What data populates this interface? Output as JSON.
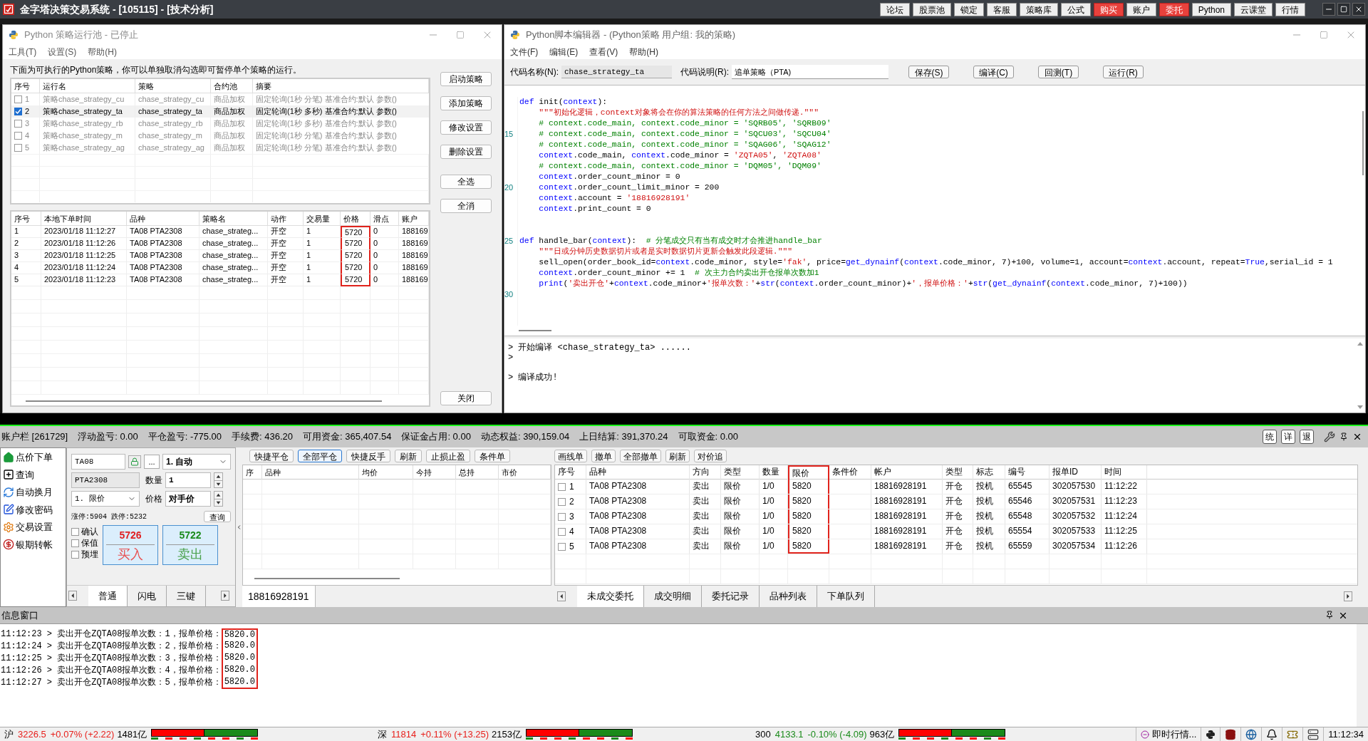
{
  "app": {
    "title": "金字塔决策交易系统 - [105115] - [技术分析]",
    "toolbar": [
      {
        "label": "论坛",
        "alert": false
      },
      {
        "label": "股票池",
        "alert": false
      },
      {
        "label": "锁定",
        "alert": false
      },
      {
        "label": "客服",
        "alert": false
      },
      {
        "label": "策略库",
        "alert": false
      },
      {
        "label": "公式",
        "alert": false
      },
      {
        "label": "购买",
        "alert": true
      },
      {
        "label": "账户",
        "alert": false
      },
      {
        "label": "委托",
        "alert": true
      },
      {
        "label": "Python",
        "alert": false
      },
      {
        "label": "云课堂",
        "alert": false
      },
      {
        "label": "行情",
        "alert": false
      }
    ]
  },
  "strategy_pool": {
    "title": "Python 策略运行池 - 已停止",
    "menu": [
      "工具(T)",
      "设置(S)",
      "帮助(H)"
    ],
    "description": "下面为可执行的Python策略，你可以单独取消勾选即可暂停单个策略的运行。",
    "columns": [
      "序号",
      "运行名",
      "策略",
      "合约池",
      "摘要"
    ],
    "strategies": [
      {
        "index": "1",
        "run_name": "策略chase_strategy_cu",
        "strategy": "chase_strategy_cu",
        "pool": "商品加权",
        "summary": "固定轮询(1秒 分笔) 基准合约:默认 参数()",
        "checked": false
      },
      {
        "index": "2",
        "run_name": "策略chase_strategy_ta",
        "strategy": "chase_strategy_ta",
        "pool": "商品加权",
        "summary": "固定轮询(1秒 多秒) 基准合约:默认 参数()",
        "checked": true
      },
      {
        "index": "3",
        "run_name": "策略chase_strategy_rb",
        "strategy": "chase_strategy_rb",
        "pool": "商品加权",
        "summary": "固定轮询(1秒 多秒) 基准合约:默认 参数()",
        "checked": false
      },
      {
        "index": "4",
        "run_name": "策略chase_strategy_m",
        "strategy": "chase_strategy_m",
        "pool": "商品加权",
        "summary": "固定轮询(1秒 分笔) 基准合约:默认 参数()",
        "checked": false
      },
      {
        "index": "5",
        "run_name": "策略chase_strategy_ag",
        "strategy": "chase_strategy_ag",
        "pool": "商品加权",
        "summary": "固定轮询(1秒 分笔) 基准合约:默认 参数()",
        "checked": false
      }
    ],
    "log_columns": [
      {
        "label": "序号",
        "highlighted": false
      },
      {
        "label": "本地下单时间",
        "highlighted": false
      },
      {
        "label": "品种",
        "highlighted": false
      },
      {
        "label": "策略名",
        "highlighted": false
      },
      {
        "label": "动作",
        "highlighted": false
      },
      {
        "label": "交易量",
        "highlighted": false
      },
      {
        "label": "价格",
        "highlighted": true
      },
      {
        "label": "滑点",
        "highlighted": false
      },
      {
        "label": "账户",
        "highlighted": false
      }
    ],
    "log_rows": [
      [
        "1",
        "2023/01/18 11:12:27",
        "TA08 PTA2308",
        "chase_strateg...",
        "开空",
        "1",
        "5720",
        "0",
        "188169"
      ],
      [
        "2",
        "2023/01/18 11:12:26",
        "TA08 PTA2308",
        "chase_strateg...",
        "开空",
        "1",
        "5720",
        "0",
        "188169"
      ],
      [
        "3",
        "2023/01/18 11:12:25",
        "TA08 PTA2308",
        "chase_strateg...",
        "开空",
        "1",
        "5720",
        "0",
        "188169"
      ],
      [
        "4",
        "2023/01/18 11:12:24",
        "TA08 PTA2308",
        "chase_strateg...",
        "开空",
        "1",
        "5720",
        "0",
        "188169"
      ],
      [
        "5",
        "2023/01/18 11:12:23",
        "TA08 PTA2308",
        "chase_strateg...",
        "开空",
        "1",
        "5720",
        "0",
        "188169"
      ]
    ],
    "side_buttons": [
      "启动策略",
      "添加策略",
      "修改设置",
      "删除设置",
      "全选",
      "全消"
    ],
    "close_button": "关闭"
  },
  "editor": {
    "title": "Python脚本编辑器 - (Python策略 用户组: 我的策略)",
    "menu": [
      "文件(F)",
      "编辑(E)",
      "查看(V)",
      "帮助(H)"
    ],
    "code_name_label": "代码名称(N):",
    "code_name": "chase_strategy_ta",
    "code_desc_label": "代码说明(R):",
    "code_desc": "追单策略（PTA)",
    "buttons": [
      "保存(S)",
      "编译(C)",
      "回测(T)",
      "运行(R)"
    ],
    "lines": [
      {
        "kind": "code",
        "tokens": [
          {
            "kind": "kw",
            "text": "def"
          },
          {
            "kind": "txt",
            "text": " init("
          },
          {
            "kind": "kw",
            "text": "context"
          },
          {
            "kind": "txt",
            "text": "):"
          }
        ]
      },
      {
        "kind": "code",
        "tokens": [
          {
            "kind": "str",
            "text": "    \"\"\"初始化逻辑，context对象将会在你的算法策略的任何方法之间做传递.\"\"\""
          }
        ]
      },
      {
        "kind": "code",
        "tokens": [
          {
            "kind": "cmt",
            "text": "    # context.code_main, context.code_minor = 'SQRB05', 'SQRB09'"
          }
        ]
      },
      {
        "kind": "code",
        "number": "15",
        "tokens": [
          {
            "kind": "cmt",
            "text": "    # context.code_main, context.code_minor = 'SQCU03', 'SQCU04'"
          }
        ]
      },
      {
        "kind": "code",
        "tokens": [
          {
            "kind": "cmt",
            "text": "    # context.code_main, context.code_minor = 'SQAG06', 'SQAG12'"
          }
        ]
      },
      {
        "kind": "code",
        "tokens": [
          {
            "kind": "kw",
            "text": "    context"
          },
          {
            "kind": "txt",
            "text": ".code_main, "
          },
          {
            "kind": "kw",
            "text": "context"
          },
          {
            "kind": "txt",
            "text": ".code_minor = "
          },
          {
            "kind": "str",
            "text": "'ZQTA05'"
          },
          {
            "kind": "txt",
            "text": ", "
          },
          {
            "kind": "str",
            "text": "'ZQTA08'"
          }
        ]
      },
      {
        "kind": "code",
        "tokens": [
          {
            "kind": "cmt",
            "text": "    # context.code_main, context.code_minor = 'DQM05', 'DQM09'"
          }
        ]
      },
      {
        "kind": "code",
        "tokens": [
          {
            "kind": "kw",
            "text": "    context"
          },
          {
            "kind": "txt",
            "text": ".order_count_minor = 0"
          }
        ]
      },
      {
        "kind": "code",
        "number": "20",
        "tokens": [
          {
            "kind": "kw",
            "text": "    context"
          },
          {
            "kind": "txt",
            "text": ".order_count_limit_minor = 200"
          }
        ]
      },
      {
        "kind": "code",
        "tokens": [
          {
            "kind": "kw",
            "text": "    context"
          },
          {
            "kind": "txt",
            "text": ".account = "
          },
          {
            "kind": "str",
            "text": "'18816928191'"
          }
        ]
      },
      {
        "kind": "code",
        "tokens": [
          {
            "kind": "kw",
            "text": "    context"
          },
          {
            "kind": "txt",
            "text": ".print_count = 0"
          }
        ]
      },
      {
        "kind": "blank"
      },
      {
        "kind": "blank"
      },
      {
        "kind": "code",
        "number": "25",
        "tokens": [
          {
            "kind": "kw",
            "text": "def"
          },
          {
            "kind": "txt",
            "text": " handle_bar("
          },
          {
            "kind": "kw",
            "text": "context"
          },
          {
            "kind": "txt",
            "text": "):  "
          },
          {
            "kind": "cmt",
            "text": "# 分笔成交只有当有成交时才会推进handle_bar"
          }
        ]
      },
      {
        "kind": "code",
        "tokens": [
          {
            "kind": "str",
            "text": "    \"\"\"日或分钟历史数据切片或者是实时数据切片更新会触发此段逻辑.\"\"\""
          }
        ]
      },
      {
        "kind": "code",
        "tokens": [
          {
            "kind": "txt",
            "text": "    sell_open(order_book_id="
          },
          {
            "kind": "kw",
            "text": "context"
          },
          {
            "kind": "txt",
            "text": ".code_minor, style="
          },
          {
            "kind": "str",
            "text": "'fak'"
          },
          {
            "kind": "txt",
            "text": ", price="
          },
          {
            "kind": "kw",
            "text": "get_dynainf"
          },
          {
            "kind": "txt",
            "text": "("
          },
          {
            "kind": "kw",
            "text": "context"
          },
          {
            "kind": "txt",
            "text": ".code_minor, 7)+100, volume=1, account="
          },
          {
            "kind": "kw",
            "text": "context"
          },
          {
            "kind": "txt",
            "text": ".account, repeat="
          },
          {
            "kind": "kw",
            "text": "True"
          },
          {
            "kind": "txt",
            "text": ",serial_id = 1"
          }
        ]
      },
      {
        "kind": "code",
        "tokens": [
          {
            "kind": "kw",
            "text": "    context"
          },
          {
            "kind": "txt",
            "text": ".order_count_minor += 1  "
          },
          {
            "kind": "cmt",
            "text": "# 次主力合约卖出开仓报单次数加1"
          }
        ]
      },
      {
        "kind": "code",
        "tokens": [
          {
            "kind": "kw",
            "text": "    print"
          },
          {
            "kind": "txt",
            "text": "("
          },
          {
            "kind": "str",
            "text": "'卖出开仓'"
          },
          {
            "kind": "txt",
            "text": "+"
          },
          {
            "kind": "kw",
            "text": "context"
          },
          {
            "kind": "txt",
            "text": ".code_minor+"
          },
          {
            "kind": "str",
            "text": "'报单次数：'"
          },
          {
            "kind": "txt",
            "text": "+"
          },
          {
            "kind": "kw",
            "text": "str"
          },
          {
            "kind": "txt",
            "text": "("
          },
          {
            "kind": "kw",
            "text": "context"
          },
          {
            "kind": "txt",
            "text": ".order_count_minor)+"
          },
          {
            "kind": "str",
            "text": "'，报单价格：'"
          },
          {
            "kind": "txt",
            "text": "+"
          },
          {
            "kind": "kw",
            "text": "str"
          },
          {
            "kind": "txt",
            "text": "("
          },
          {
            "kind": "kw",
            "text": "get_dynainf"
          },
          {
            "kind": "txt",
            "text": "("
          },
          {
            "kind": "kw",
            "text": "context"
          },
          {
            "kind": "txt",
            "text": ".code_minor, 7)+100))"
          }
        ]
      },
      {
        "kind": "blank",
        "number": "30"
      }
    ],
    "output": [
      "> 开始编译 <chase_strategy_ta> ......",
      ">",
      "> 编译成功!"
    ]
  },
  "account_bar": {
    "items": [
      "账户栏 [261729]",
      "浮动盈亏: 0.00",
      "平仓盈亏: -775.00",
      "手续费: 436.20",
      "可用资金: 365,407.54",
      "保证金占用: 0.00",
      "动态权益: 390,159.04",
      "上日结算: 391,370.24",
      "可取资金: 0.00"
    ],
    "buttons": [
      "统",
      "详",
      "退"
    ]
  },
  "nav": [
    "点价下单",
    "查询",
    "自动换月",
    "修改密码",
    "交易设置",
    "银期转帐"
  ],
  "order_form": {
    "contract": "TA08",
    "more_button": "...",
    "mode": "1. 自动",
    "product": "PTA2308",
    "qty_label": "数量",
    "qty": "1",
    "order_type": "1. 限价",
    "price_label": "价格",
    "price": "对手价",
    "limits": "涨停:5904 跌停:5232",
    "query_button": "查询",
    "options": [
      {
        "label": "确认",
        "checked": false
      },
      {
        "label": "保值",
        "checked": false
      },
      {
        "label": "预埋",
        "checked": false
      }
    ],
    "buy": {
      "price": "5726",
      "label": "买入"
    },
    "sell": {
      "price": "5722",
      "label": "卖出"
    },
    "tabs": [
      {
        "label": "普通",
        "selected": true
      },
      {
        "label": "闪电",
        "selected": false
      },
      {
        "label": "三键",
        "selected": false
      }
    ]
  },
  "positions": {
    "toolbar": [
      {
        "label": "快捷平仓",
        "selected": false
      },
      {
        "label": "全部平仓",
        "selected": true
      },
      {
        "label": "快捷反手",
        "selected": false
      },
      {
        "label": "刷新",
        "selected": false
      },
      {
        "label": "止损止盈",
        "selected": false
      },
      {
        "label": "条件单",
        "selected": false
      }
    ],
    "columns": [
      "序",
      "品种",
      "均价",
      "今持",
      "总持",
      "市价"
    ],
    "account_tab": "18816928191"
  },
  "orders": {
    "toolbar": [
      "画线单",
      "撤单",
      "全部撤单",
      "刷新",
      "对价追"
    ],
    "columns": [
      {
        "label": "序号",
        "highlighted": false
      },
      {
        "label": "品种",
        "highlighted": false
      },
      {
        "label": "方向",
        "highlighted": false
      },
      {
        "label": "类型",
        "highlighted": false
      },
      {
        "label": "数量",
        "highlighted": false
      },
      {
        "label": "限价",
        "highlighted": true
      },
      {
        "label": "条件价",
        "highlighted": false
      },
      {
        "label": "帐户",
        "highlighted": false
      },
      {
        "label": "类型",
        "highlighted": false
      },
      {
        "label": "标志",
        "highlighted": false
      },
      {
        "label": "编号",
        "highlighted": false
      },
      {
        "label": "报单ID",
        "highlighted": false
      },
      {
        "label": "时间",
        "highlighted": false
      }
    ],
    "rows": [
      {
        "index": "1",
        "contract": "TA08 PTA2308",
        "direction": "卖出",
        "type": "限价",
        "qty": "1/0",
        "limit_price": "5820",
        "account": "18816928191",
        "open_close": "开仓",
        "flag": "投机",
        "order_no": "65545",
        "order_id": "302057530",
        "time": "11:12:22",
        "checked": false
      },
      {
        "index": "2",
        "contract": "TA08 PTA2308",
        "direction": "卖出",
        "type": "限价",
        "qty": "1/0",
        "limit_price": "5820",
        "account": "18816928191",
        "open_close": "开仓",
        "flag": "投机",
        "order_no": "65546",
        "order_id": "302057531",
        "time": "11:12:23",
        "checked": false
      },
      {
        "index": "3",
        "contract": "TA08 PTA2308",
        "direction": "卖出",
        "type": "限价",
        "qty": "1/0",
        "limit_price": "5820",
        "account": "18816928191",
        "open_close": "开仓",
        "flag": "投机",
        "order_no": "65548",
        "order_id": "302057532",
        "time": "11:12:24",
        "checked": false
      },
      {
        "index": "4",
        "contract": "TA08 PTA2308",
        "direction": "卖出",
        "type": "限价",
        "qty": "1/0",
        "limit_price": "5820",
        "account": "18816928191",
        "open_close": "开仓",
        "flag": "投机",
        "order_no": "65554",
        "order_id": "302057533",
        "time": "11:12:25",
        "checked": false
      },
      {
        "index": "5",
        "contract": "TA08 PTA2308",
        "direction": "卖出",
        "type": "限价",
        "qty": "1/0",
        "limit_price": "5820",
        "account": "18816928191",
        "open_close": "开仓",
        "flag": "投机",
        "order_no": "65559",
        "order_id": "302057534",
        "time": "11:12:26",
        "checked": false
      }
    ],
    "tabs": [
      {
        "label": "未成交委托",
        "selected": true
      },
      {
        "label": "成交明细",
        "selected": false
      },
      {
        "label": "委托记录",
        "selected": false
      },
      {
        "label": "品种列表",
        "selected": false
      },
      {
        "label": "下单队列",
        "selected": false
      }
    ]
  },
  "info": {
    "title": "信息窗口",
    "value_highlighted": true,
    "lines": [
      {
        "time": "11:12:23",
        "message": "> 卖出开仓ZQTA08报单次数：1，报单价格：",
        "value": "5820.0"
      },
      {
        "time": "11:12:24",
        "message": "> 卖出开仓ZQTA08报单次数：2，报单价格：",
        "value": "5820.0"
      },
      {
        "time": "11:12:25",
        "message": "> 卖出开仓ZQTA08报单次数：3，报单价格：",
        "value": "5820.0"
      },
      {
        "time": "11:12:26",
        "message": "> 卖出开仓ZQTA08报单次数：4，报单价格：",
        "value": "5820.0"
      },
      {
        "time": "11:12:27",
        "message": "> 卖出开仓ZQTA08报单次数：5，报单价格：",
        "value": "5820.0"
      }
    ]
  },
  "status_bar": {
    "indices": [
      {
        "label": "沪",
        "value": "3226.5",
        "change": "+0.07% (+2.22)",
        "amount": "1481亿",
        "up": true,
        "level": 0.5
      },
      {
        "label": "深",
        "value": "11814",
        "change": "+0.11% (+13.25)",
        "amount": "2153亿",
        "up": true,
        "level": 0.5
      },
      {
        "label": "300",
        "value": "4133.1",
        "change": "-0.10% (-4.09)",
        "amount": "963亿",
        "up": false,
        "level": 0.5
      }
    ],
    "quote_button": "即时行情...",
    "clock": "11:12:34"
  }
}
